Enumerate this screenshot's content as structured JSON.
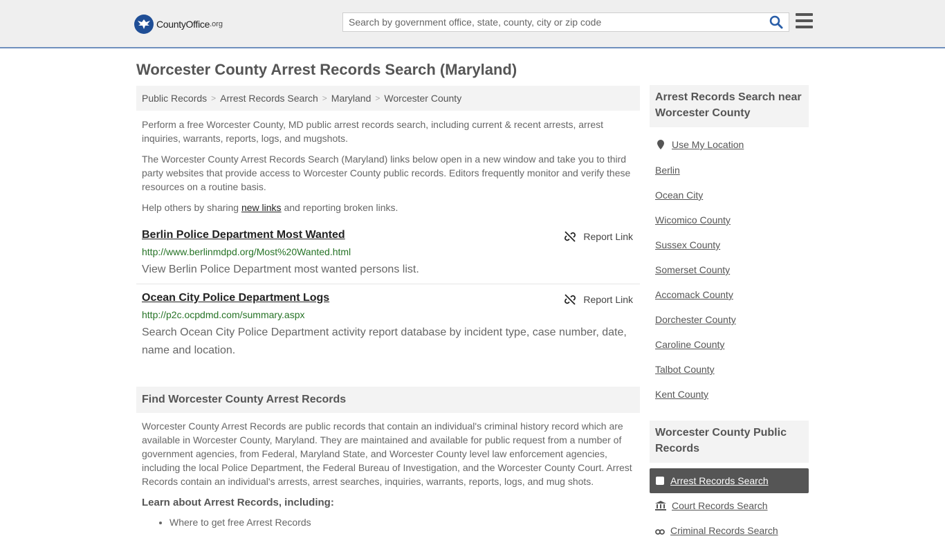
{
  "header": {
    "logo_name": "CountyOffice",
    "logo_ext": ".org",
    "search_placeholder": "Search by government office, state, county, city or zip code"
  },
  "page_title": "Worcester County Arrest Records Search (Maryland)",
  "breadcrumb": [
    "Public Records",
    "Arrest Records Search",
    "Maryland",
    "Worcester County"
  ],
  "intro": {
    "p1": "Perform a free Worcester County, MD public arrest records search, including current & recent arrests, arrest inquiries, warrants, reports, logs, and mugshots.",
    "p2": "The Worcester County Arrest Records Search (Maryland) links below open in a new window and take you to third party websites that provide access to Worcester County public records. Editors frequently monitor and verify these resources on a routine basis.",
    "p3_before": "Help others by sharing ",
    "p3_link": "new links",
    "p3_after": " and reporting broken links."
  },
  "report_label": "Report Link",
  "records": [
    {
      "title": "Berlin Police Department Most Wanted",
      "url": "http://www.berlinmdpd.org/Most%20Wanted.html",
      "desc": "View Berlin Police Department most wanted persons list."
    },
    {
      "title": "Ocean City Police Department Logs",
      "url": "http://p2c.ocpdmd.com/summary.aspx",
      "desc": "Search Ocean City Police Department activity report database by incident type, case number, date, name and location."
    }
  ],
  "find_section": {
    "heading": "Find Worcester County Arrest Records",
    "body": "Worcester County Arrest Records are public records that contain an individual's criminal history record which are available in Worcester County, Maryland. They are maintained and available for public request from a number of government agencies, from Federal, Maryland State, and Worcester County level law enforcement agencies, including the local Police Department, the Federal Bureau of Investigation, and the Worcester County Court. Arrest Records contain an individual's arrests, arrest searches, inquiries, warrants, reports, logs, and mug shots.",
    "learn_heading": "Learn about Arrest Records, including:",
    "bullets": [
      "Where to get free Arrest Records"
    ]
  },
  "sidebar": {
    "near_heading": "Arrest Records Search near Worcester County",
    "use_location": "Use My Location",
    "near_links": [
      "Berlin",
      "Ocean City",
      "Wicomico County",
      "Sussex County",
      "Somerset County",
      "Accomack County",
      "Dorchester County",
      "Caroline County",
      "Talbot County",
      "Kent County"
    ],
    "public_heading": "Worcester County Public Records",
    "public_items": [
      "Arrest Records Search",
      "Court Records Search",
      "Criminal Records Search"
    ]
  },
  "colors": {
    "accent_border": "#6f8fbd",
    "logo_blue": "#1f4e96",
    "url_green": "#267326",
    "active_item_bg": "#555555"
  }
}
